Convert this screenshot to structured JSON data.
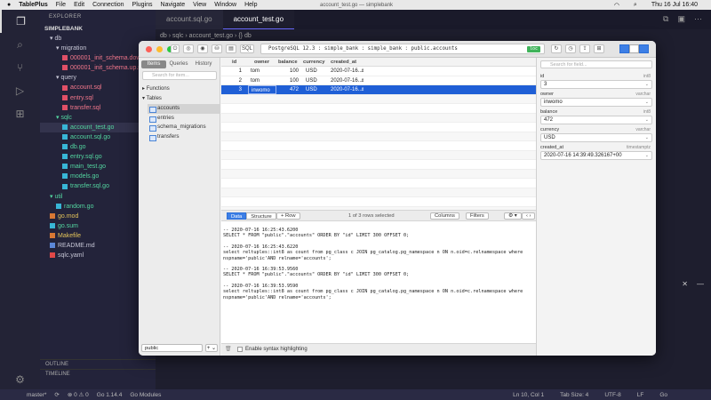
{
  "menubar": {
    "app": "TablePlus",
    "items": [
      "File",
      "Edit",
      "Connection",
      "Plugins",
      "Navigate",
      "View",
      "Window",
      "Help"
    ],
    "window_title": "account_test.go — simplebank",
    "clock": "Thu 16 Jul  16:40"
  },
  "explorer": {
    "header": "EXPLORER",
    "project": "SIMPLEBANK",
    "items": [
      {
        "label": "db",
        "kind": "dir",
        "indent": 1
      },
      {
        "label": "migration",
        "kind": "dir",
        "indent": 2
      },
      {
        "label": "000001_init_schema.down.sql",
        "kind": "sql",
        "indent": 3
      },
      {
        "label": "000001_init_schema.up.sql",
        "kind": "sql",
        "indent": 3
      },
      {
        "label": "query",
        "kind": "dir",
        "indent": 2
      },
      {
        "label": "account.sql",
        "kind": "sql",
        "indent": 3
      },
      {
        "label": "entry.sql",
        "kind": "sql",
        "indent": 3
      },
      {
        "label": "transfer.sql",
        "kind": "sql",
        "indent": 3
      },
      {
        "label": "sqlc",
        "kind": "dir-go",
        "indent": 2
      },
      {
        "label": "account_test.go",
        "kind": "go",
        "indent": 3
      },
      {
        "label": "account.sql.go",
        "kind": "go",
        "indent": 3
      },
      {
        "label": "db.go",
        "kind": "go",
        "indent": 3
      },
      {
        "label": "entry.sql.go",
        "kind": "go",
        "indent": 3
      },
      {
        "label": "main_test.go",
        "kind": "go",
        "indent": 3
      },
      {
        "label": "models.go",
        "kind": "go",
        "indent": 3
      },
      {
        "label": "transfer.sql.go",
        "kind": "go",
        "indent": 3
      },
      {
        "label": "util",
        "kind": "dir-go",
        "indent": 1
      },
      {
        "label": "random.go",
        "kind": "go",
        "indent": 2
      },
      {
        "label": "go.mod",
        "kind": "mod",
        "indent": 1
      },
      {
        "label": "go.sum",
        "kind": "go",
        "indent": 1
      },
      {
        "label": "Makefile",
        "kind": "mk",
        "indent": 1
      },
      {
        "label": "README.md",
        "kind": "md",
        "indent": 1
      },
      {
        "label": "sqlc.yaml",
        "kind": "yml",
        "indent": 1
      }
    ],
    "outline": "OUTLINE",
    "timeline": "TIMELINE"
  },
  "editor": {
    "tabs": [
      {
        "label": "account.sql.go",
        "active": false
      },
      {
        "label": "account_test.go",
        "active": true
      }
    ],
    "breadcrumb": "db › sqlc › account_test.go › {} db"
  },
  "tableplus": {
    "connection": "PostgreSQL 12.3 : simple_bank : simple_bank : public.accounts",
    "conn_badge": "loc",
    "toolbar_sql_label": "SQL",
    "sidebar": {
      "tabs": [
        "Items",
        "Queries",
        "History"
      ],
      "search_placeholder": "Search for item...",
      "functions_label": "Functions",
      "tables_label": "Tables",
      "tables": [
        "accounts",
        "entries",
        "schema_migrations",
        "transfers"
      ],
      "schema": "public",
      "add": "+ ⌄"
    },
    "grid": {
      "columns": [
        "id",
        "owner",
        "balance",
        "currency",
        "created_at"
      ],
      "rows": [
        {
          "id": "1",
          "owner": "tom",
          "balance": "100",
          "currency": "USD",
          "created_at": "2020-07-16..."
        },
        {
          "id": "2",
          "owner": "tom",
          "balance": "100",
          "currency": "USD",
          "created_at": "2020-07-16..."
        },
        {
          "id": "3",
          "owner": "inwomo",
          "balance": "472",
          "currency": "USD",
          "created_at": "2020-07-16..."
        }
      ]
    },
    "gridbar": {
      "data": "Data",
      "structure": "Structure",
      "add_row": "+ Row",
      "status": "1 of 3 rows selected",
      "columns": "Columns",
      "filters": "Filters"
    },
    "detail": {
      "search_placeholder": "Search for field...",
      "fields": [
        {
          "name": "id",
          "type": "int8",
          "value": "3"
        },
        {
          "name": "owner",
          "type": "varchar",
          "value": "inwomo"
        },
        {
          "name": "balance",
          "type": "int8",
          "value": "472"
        },
        {
          "name": "currency",
          "type": "varchar",
          "value": "USD"
        },
        {
          "name": "created_at",
          "type": "timestamptz",
          "value": "2020-07-16 14:39:49.326167+00"
        }
      ]
    },
    "console": [
      "-- 2020-07-16 16:25:43.6200\nSELECT * FROM \"public\".\"accounts\" ORDER BY \"id\" LIMIT 300 OFFSET 0;",
      "-- 2020-07-16 16:25:43.6220\nselect reltuples::int8 as count from pg_class c JOIN pg_catalog.pg_namespace n ON n.oid=c.relnamespace where\nnspname='public'AND relname='accounts';",
      "-- 2020-07-16 16:39:53.9560\nSELECT * FROM \"public\".\"accounts\" ORDER BY \"id\" LIMIT 300 OFFSET 0;",
      "-- 2020-07-16 16:39:53.9590\nselect reltuples::int8 as count from pg_class c JOIN pg_catalog.pg_namespace n ON n.oid=c.relnamespace where\nnspname='public'AND relname='accounts';"
    ],
    "syntax_label": "Enable syntax highlighting"
  },
  "statusbar": {
    "branch": "master*",
    "sync": "⟳",
    "problems": "⊗ 0 ⚠ 0",
    "go_version": "Go 1.14.4",
    "go_modules": "Go Modules",
    "position": "Ln 10, Col 1",
    "tab_size": "Tab Size: 4",
    "encoding": "UTF-8",
    "eol": "LF",
    "lang": "Go"
  },
  "colors": {
    "accent": "#1f5fd6",
    "vscode_bg": "#1e1e2e"
  }
}
